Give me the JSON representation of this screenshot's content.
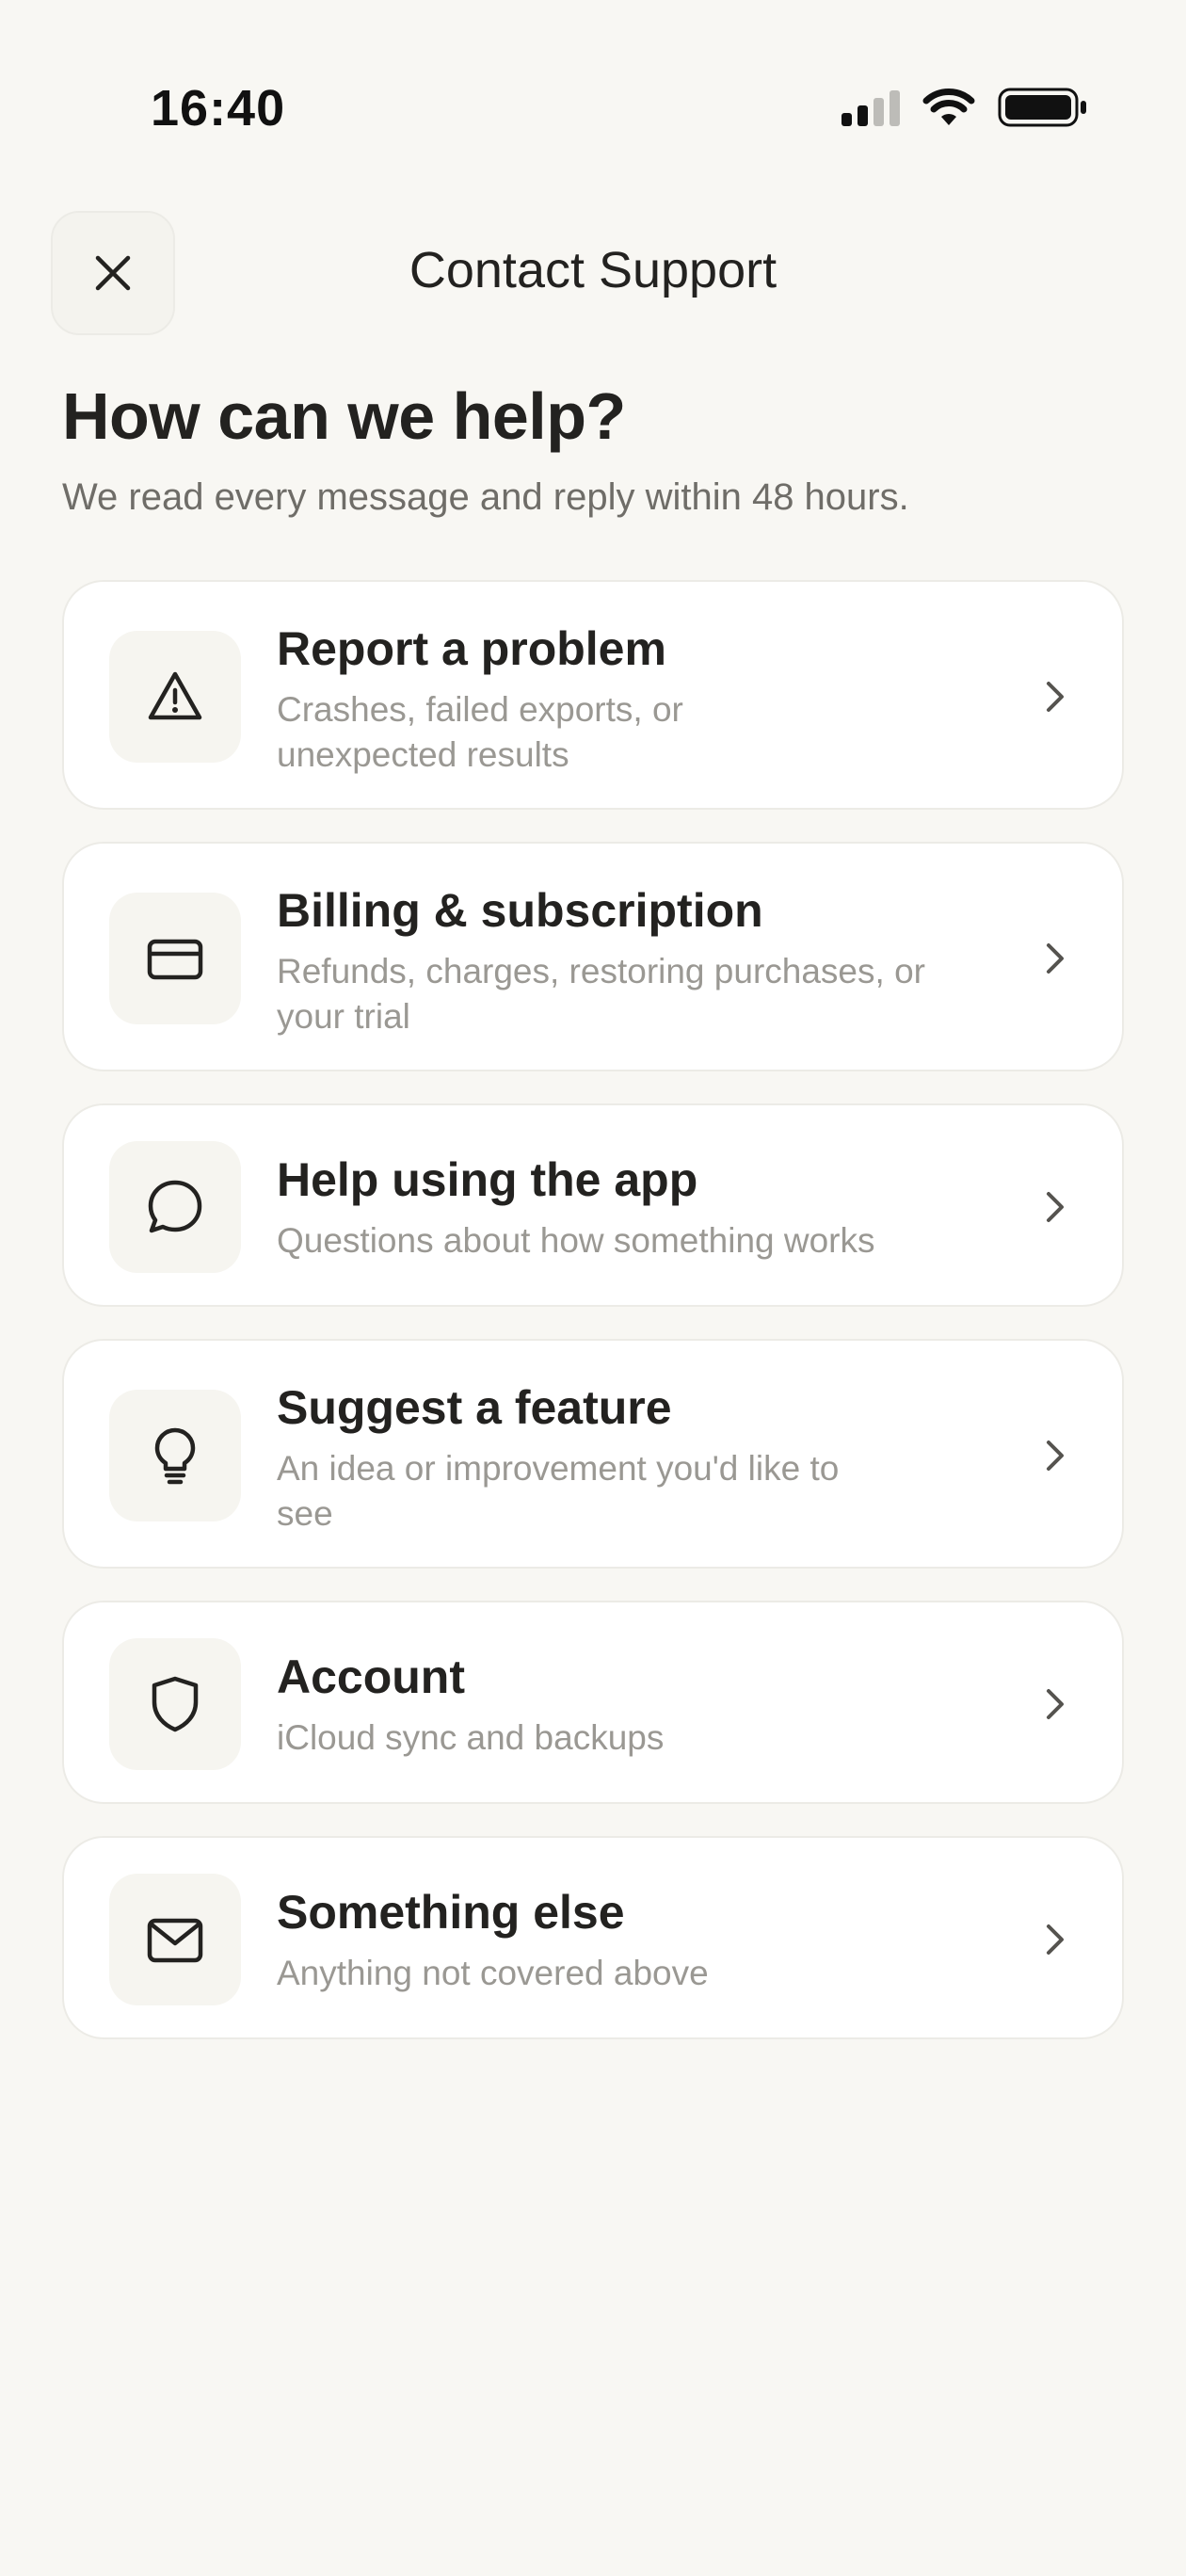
{
  "status_bar": {
    "time": "16:40"
  },
  "header": {
    "title": "Contact Support",
    "close_icon": "close-icon"
  },
  "intro": {
    "heading": "How can we help?",
    "subheading": "We read every message and reply within 48 hours."
  },
  "options": [
    {
      "icon": "warning-triangle-icon",
      "title": "Report a problem",
      "description": "Crashes, failed exports, or unexpected results"
    },
    {
      "icon": "credit-card-icon",
      "title": "Billing & subscription",
      "description": "Refunds, charges, restoring purchases, or your trial"
    },
    {
      "icon": "chat-bubble-icon",
      "title": "Help using the app",
      "description": "Questions about how something works"
    },
    {
      "icon": "lightbulb-icon",
      "title": "Suggest a feature",
      "description": "An idea or improvement you'd like to see"
    },
    {
      "icon": "shield-icon",
      "title": "Account",
      "description": "iCloud sync and backups"
    },
    {
      "icon": "envelope-icon",
      "title": "Something else",
      "description": "Anything not covered above"
    }
  ],
  "colors": {
    "background": "#f8f7f3",
    "card": "#ffffff",
    "text_primary": "#232220",
    "text_secondary": "#9a9893"
  }
}
